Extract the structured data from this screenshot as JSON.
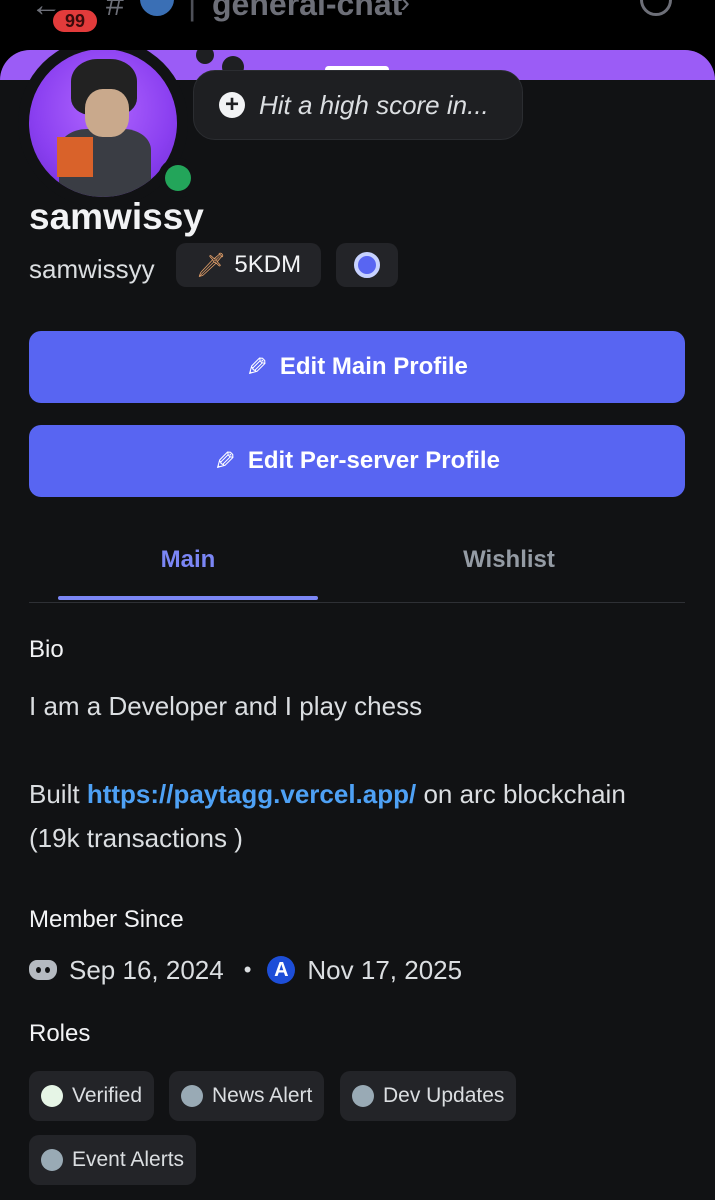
{
  "topbar": {
    "badge_count": "99",
    "channel_name": "general-chat"
  },
  "profile": {
    "status_text": "Hit a high score in...",
    "display_name": "samwissy",
    "username": "samwissyy",
    "tag": "5KDM"
  },
  "buttons": {
    "edit_main": "Edit Main Profile",
    "edit_server": "Edit Per-server Profile"
  },
  "tabs": [
    {
      "label": "Main",
      "active": true
    },
    {
      "label": "Wishlist",
      "active": false
    }
  ],
  "bio": {
    "label": "Bio",
    "line1": "I am a Developer and I play chess",
    "line2_prefix": "Built",
    "line2_link": "https://paytagg.vercel.app/",
    "line2_suffix": "on arc blockchain",
    "line3": "(19k transactions )"
  },
  "member_since": {
    "label": "Member Since",
    "discord_date": "Sep 16, 2024",
    "server_date": "Nov 17, 2025"
  },
  "roles": {
    "label": "Roles",
    "items": [
      {
        "name": "Verified",
        "color": "#e6f5e6"
      },
      {
        "name": "News Alert",
        "color": "#99aab5"
      },
      {
        "name": "Dev Updates",
        "color": "#99aab5"
      },
      {
        "name": "Event Alerts",
        "color": "#99aab5"
      }
    ]
  },
  "colors": {
    "accent": "#5865f2",
    "banner": "#9b5cf6",
    "online": "#23a55a",
    "link": "#4ea1f5"
  }
}
